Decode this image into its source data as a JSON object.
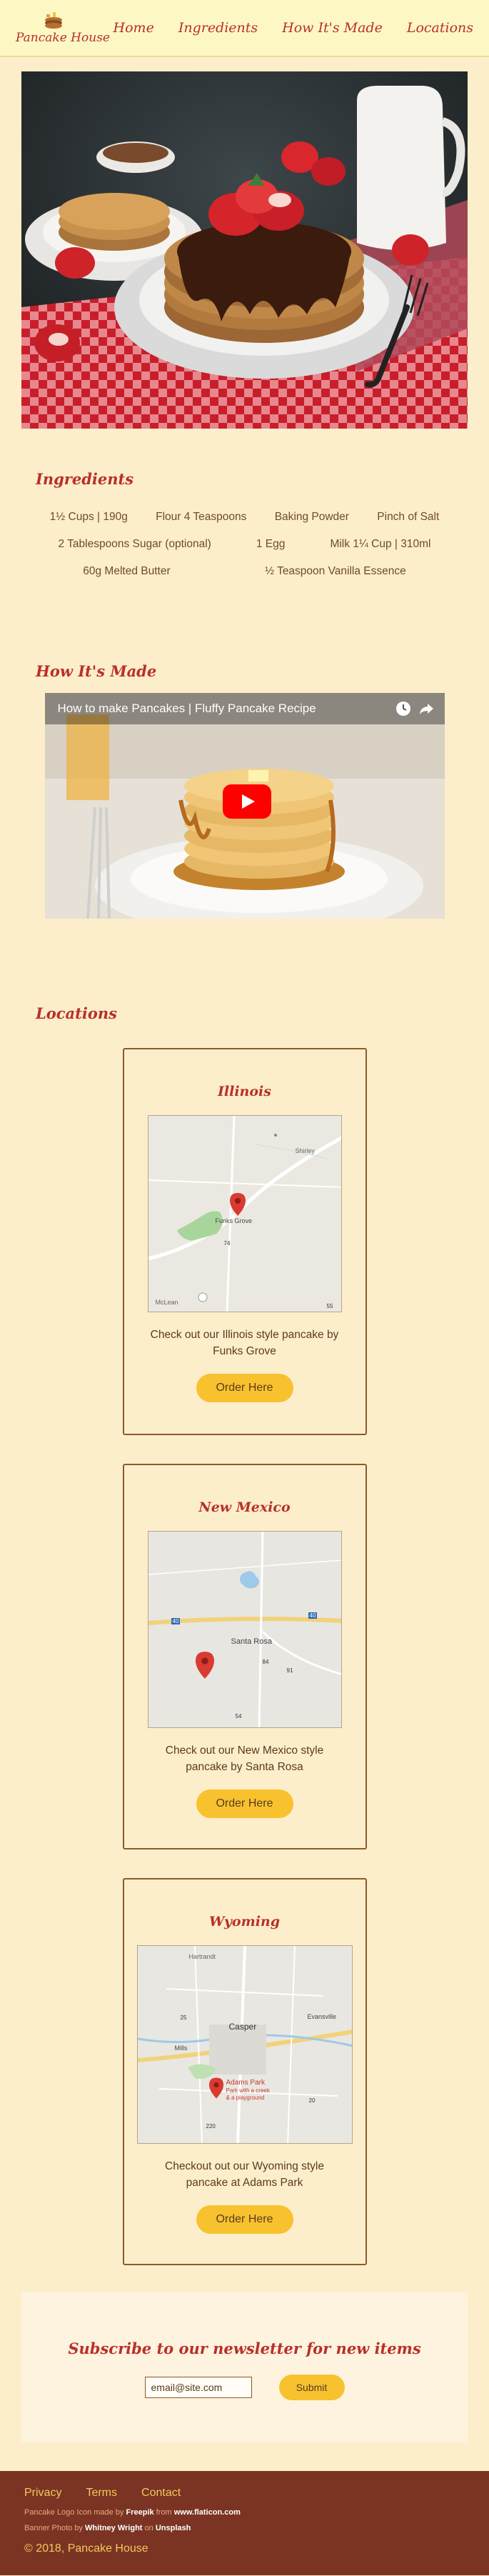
{
  "nav": {
    "brand": "Pancake House",
    "links": [
      "Home",
      "Ingredients",
      "How It's Made",
      "Locations"
    ]
  },
  "ingredients": {
    "title": "Ingredients",
    "rows": [
      [
        "1½ Cups | 190g",
        "Flour 4 Teaspoons",
        "Baking Powder",
        "Pinch of Salt"
      ],
      [
        "2 Tablespoons Sugar (optional)",
        "1 Egg",
        "Milk 1¼ Cup | 310ml"
      ],
      [
        "60g Melted Butter",
        "½ Teaspoon Vanilla Essence"
      ]
    ]
  },
  "howto": {
    "title": "How It's Made",
    "video_title": "How to make Pancakes | Fluffy Pancake Recipe"
  },
  "locations": {
    "title": "Locations",
    "cards": [
      {
        "name": "Illinois",
        "description": "Check out our Illinois style pancake by Funks Grove",
        "button": "Order Here",
        "map_labels": [
          "Shirley",
          "Funks Grove",
          "McLean",
          "74",
          "55"
        ]
      },
      {
        "name": "New Mexico",
        "description": "Check out our New Mexico style pancake by Santa Rosa",
        "button": "Order Here",
        "map_labels": [
          "Santa Rosa",
          "40",
          "40",
          "84",
          "91",
          "54"
        ]
      },
      {
        "name": "Wyoming",
        "description": "Checkout out our Wyoming style pancake at Adams Park",
        "button": "Order Here",
        "map_labels": [
          "Hartrandt",
          "Casper",
          "Mills",
          "Evansville",
          "Adams Park",
          "Park with a creek",
          "& a playground",
          "25",
          "220",
          "20"
        ]
      }
    ]
  },
  "newsletter": {
    "title": "Subscribe to our newsletter for new items",
    "input_value": "email@site.com",
    "button": "Submit"
  },
  "footer": {
    "links": [
      "Privacy",
      "Terms",
      "Contact"
    ],
    "credit1": {
      "prefix": "Pancake Logo Icon made by ",
      "author": "Freepik",
      "mid": " from ",
      "site": "www.flaticon.com"
    },
    "credit2": {
      "prefix": "Banner Photo by ",
      "author": "Whitney Wright",
      "mid": " on ",
      "site": "Unsplash"
    },
    "copyright": "© 2018, Pancake House"
  },
  "colors": {
    "background": "#fdeecb",
    "accent": "#b8302a",
    "button": "#f8c22f",
    "footer": "#7b3423"
  },
  "icons": [
    "pancake-logo-icon",
    "clock-icon",
    "share-icon",
    "youtube-play-icon",
    "map-pin-icon"
  ]
}
